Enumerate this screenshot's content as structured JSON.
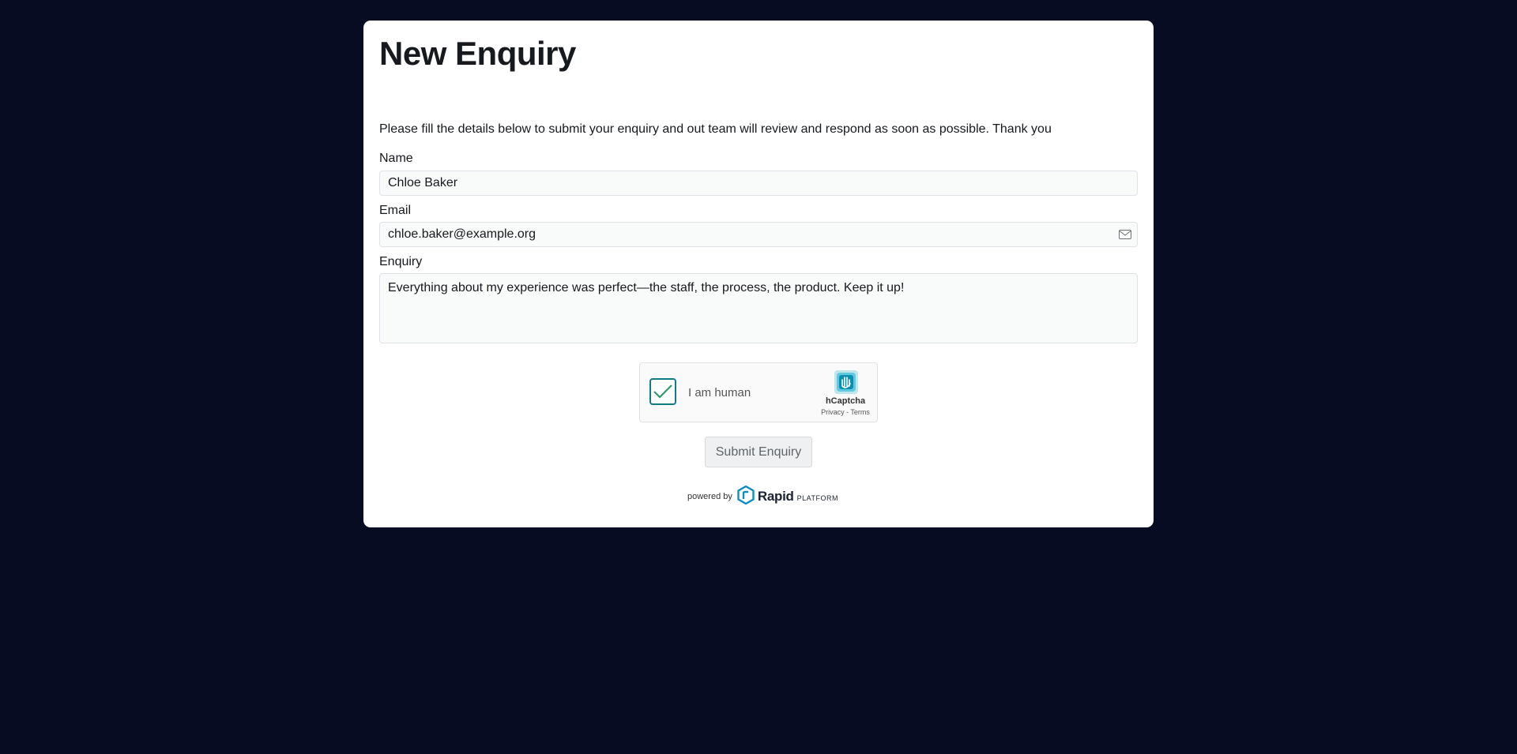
{
  "form": {
    "title": "New Enquiry",
    "intro": "Please fill the details below to submit your enquiry and out team will review and respond as soon as possible. Thank you",
    "name_label": "Name",
    "name_value": "Chloe Baker",
    "email_label": "Email",
    "email_value": "chloe.baker@example.org",
    "enquiry_label": "Enquiry",
    "enquiry_value": "Everything about my experience was perfect—the staff, the process, the product. Keep it up!",
    "submit_label": "Submit Enquiry"
  },
  "captcha": {
    "label": "I am human",
    "checked": true,
    "brand": "hCaptcha",
    "links": "Privacy - Terms",
    "check_color": "#0f7d86",
    "logo_icon": "hcaptcha-hand-icon"
  },
  "footer": {
    "powered_text": "powered by",
    "brand": "Rapid",
    "brand_suffix": "PLATFORM",
    "logo_icon": "rapid-hex-icon",
    "brand_color": "#0e8fc4"
  },
  "colors": {
    "background": "#080c22",
    "card": "#ffffff",
    "text": "#16191d"
  }
}
